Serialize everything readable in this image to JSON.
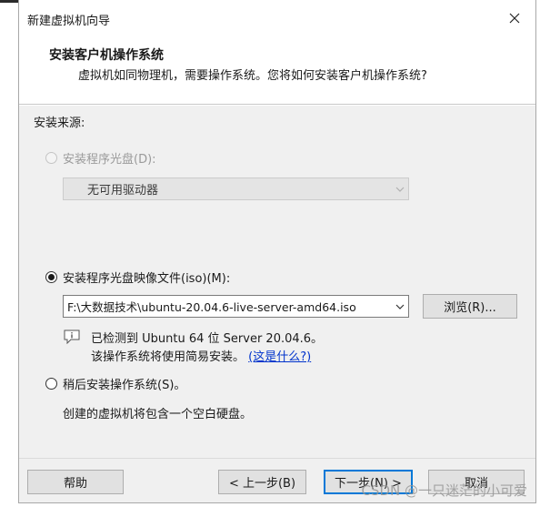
{
  "window": {
    "title": "新建虚拟机向导",
    "close_glyph": "✕"
  },
  "header": {
    "title": "安装客户机操作系统",
    "subtitle": "虚拟机如同物理机，需要操作系统。您将如何安装客户机操作系统?"
  },
  "install_source": {
    "label": "安装来源:",
    "disc_option": {
      "label": "安装程序光盘(D):",
      "selected": false,
      "enabled": false,
      "drive_value": "无可用驱动器"
    },
    "iso_option": {
      "label": "安装程序光盘映像文件(iso)(M):",
      "selected": true,
      "path_value": "F:\\大数据技术\\ubuntu-20.04.6-live-server-amd64.iso",
      "browse_label": "浏览(R)...",
      "detected_line": "已检测到 Ubuntu 64 位 Server 20.04.6。",
      "easy_install_text": "该操作系统将使用简易安装。",
      "whats_this_link": "(这是什么?)"
    },
    "later_option": {
      "label": "稍后安装操作系统(S)。",
      "selected": false,
      "description": "创建的虚拟机将包含一个空白硬盘。"
    }
  },
  "footer": {
    "help_label": "帮助",
    "back_label": "< 上一步(B)",
    "next_label": "下一步(N) >",
    "cancel_label": "取消"
  },
  "watermark": "CSDN @一只迷茫的小可爱",
  "colors": {
    "dialog_bg": "#f0f0f0",
    "header_bg": "#ffffff",
    "link": "#0033cc",
    "default_button_border": "#0078d7"
  }
}
